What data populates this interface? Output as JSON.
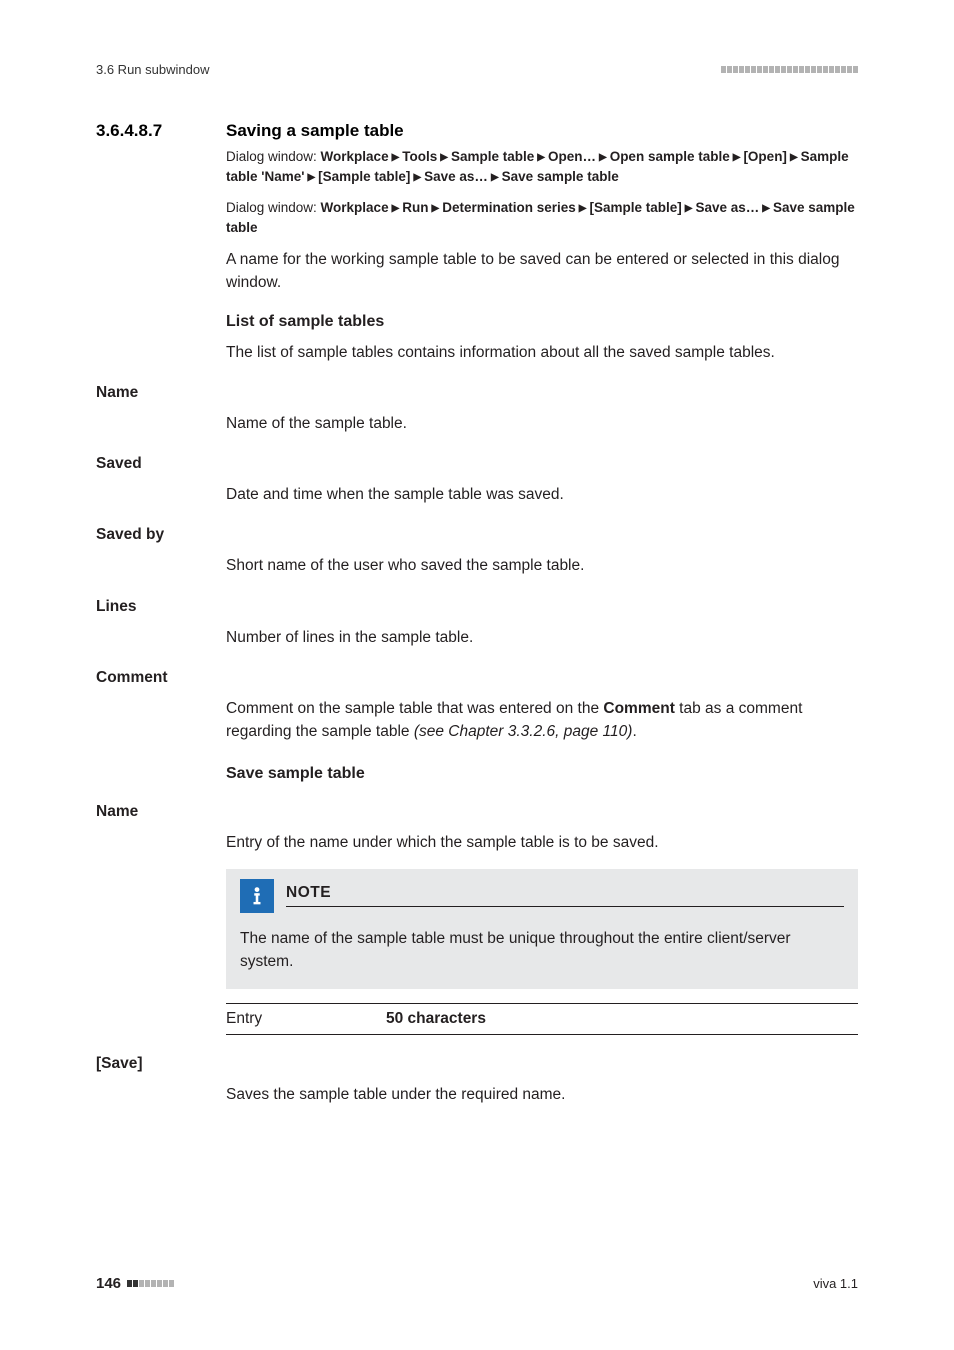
{
  "running_header": "3.6 Run subwindow",
  "section": {
    "number": "3.6.4.8.7",
    "title": "Saving a sample table"
  },
  "breadcrumbs": [
    {
      "label": "Dialog window: ",
      "path": [
        "Workplace",
        "Tools",
        "Sample table",
        "Open…",
        "Open sample table",
        "[Open]",
        "Sample table 'Name'",
        "[Sample table]",
        "Save as…",
        "Save sample table"
      ]
    },
    {
      "label": "Dialog window: ",
      "path": [
        "Workplace",
        "Run",
        "Determination series",
        "[Sample table]",
        "Save as…",
        "Save sample table"
      ]
    }
  ],
  "intro_para": "A name for the working sample table to be saved can be entered or selected in this dialog window.",
  "list_heading": "List of sample tables",
  "list_desc": "The list of sample tables contains information about all the saved sample tables.",
  "fields": [
    {
      "term": "Name",
      "desc_plain": "Name of the sample table."
    },
    {
      "term": "Saved",
      "desc_plain": "Date and time when the sample table was saved."
    },
    {
      "term": "Saved by",
      "desc_plain": "Short name of the user who saved the sample table."
    },
    {
      "term": "Lines",
      "desc_plain": "Number of lines in the sample table."
    }
  ],
  "comment": {
    "term": "Comment",
    "pre": "Comment on the sample table that was entered on the ",
    "bold": "Comment",
    "mid": " tab as a comment regarding the sample table ",
    "ital": "(see Chapter 3.3.2.6, page 110)",
    "post": "."
  },
  "save_heading": "Save sample table",
  "save_name": {
    "term": "Name",
    "desc": "Entry of the name under which the sample table is to be saved."
  },
  "note": {
    "title": "NOTE",
    "body": "The name of the sample table must be unique throughout the entire client/server system."
  },
  "entry": {
    "label": "Entry",
    "value": "50 characters"
  },
  "save_button": {
    "term": "[Save]",
    "desc": "Saves the sample table under the required name."
  },
  "footer": {
    "page": "146",
    "version": "viva 1.1"
  }
}
